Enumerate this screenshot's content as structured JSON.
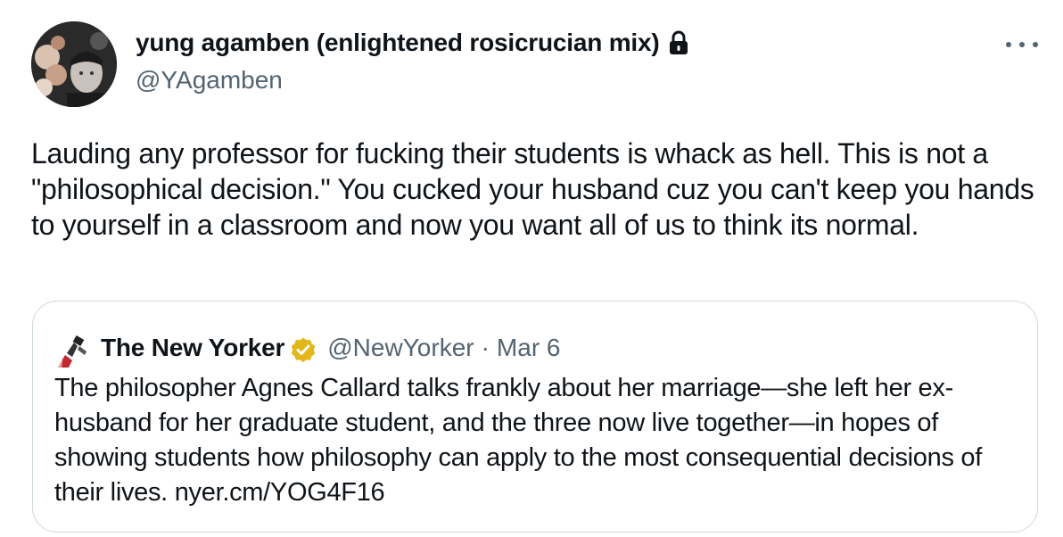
{
  "tweet": {
    "author_name": "yung agamben (enlightened rosicrucian mix)",
    "author_handle": "@YAgamben",
    "text": "Lauding any professor for fucking their students is whack as hell. This is not a \"philosophical decision.\" You cucked your husband cuz you can't keep you hands to yourself in a classroom and now you want all of us to think its normal.",
    "icons": {
      "lock": "lock-icon",
      "more": "more-horizontal-icon"
    }
  },
  "quote": {
    "author_name": "The New Yorker",
    "author_handle": "@NewYorker",
    "separator": "·",
    "date": "Mar 6",
    "text": "The philosopher Agnes Callard talks frankly about her marriage—she left her ex-husband for her graduate student, and the three now live together—in hopes of showing students how philosophy can apply to the most consequential decisions of their lives.",
    "link": "nyer.cm/YOG4F16",
    "icons": {
      "verified": "verified-gold-badge-icon",
      "avatar": "new-yorker-logo-icon"
    }
  },
  "colors": {
    "text_primary": "#0f1419",
    "text_secondary": "#536471",
    "border": "#cfd9de",
    "verified_gold": "#e2b719"
  }
}
